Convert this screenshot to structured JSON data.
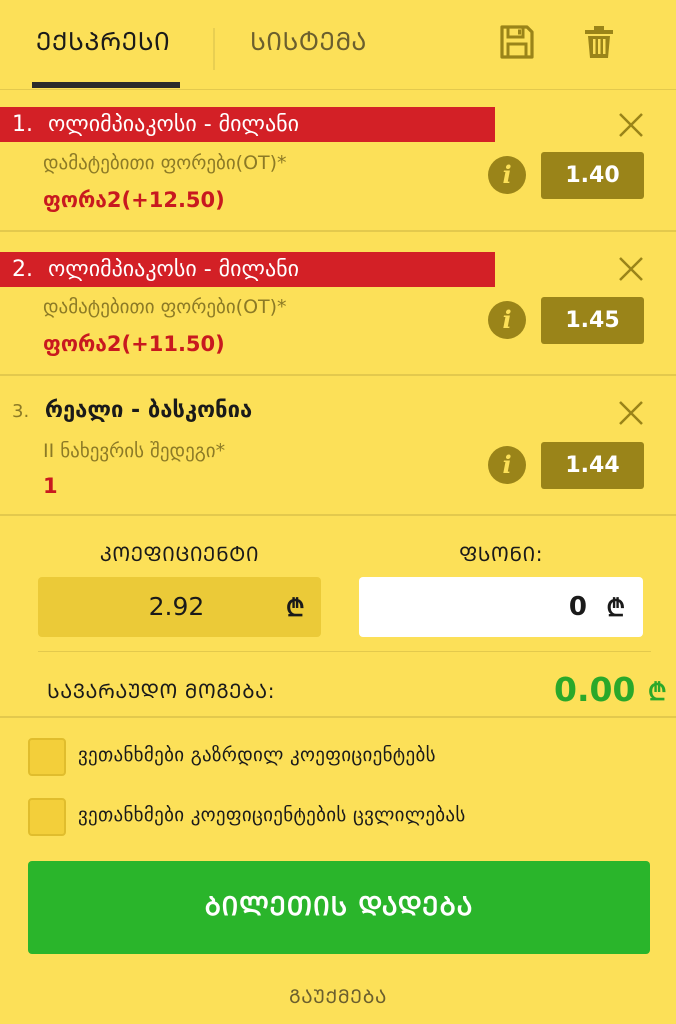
{
  "tabs": {
    "express": "ᲔᲥᲡᲞᲠᲔᲡᲘ",
    "system": "ᲡᲘᲡᲢᲔᲛᲐ"
  },
  "icons": {
    "save": "save-icon",
    "trash": "trash-icon",
    "close": "close-icon",
    "info": "info-icon",
    "currency": "lari-icon"
  },
  "bets": [
    {
      "number": "1.",
      "match": "ოლიმპიაკოსი - მილანი",
      "market": "დამატებითი ფორები(OT)*",
      "selection": "ფორა2(+12.50)",
      "odds": "1.40",
      "info_glyph": "i"
    },
    {
      "number": "2.",
      "match": "ოლიმპიაკოსი - მილანი",
      "market": "დამატებითი ფორები(OT)*",
      "selection": "ფორა2(+11.50)",
      "odds": "1.45",
      "info_glyph": "i"
    },
    {
      "number": "3.",
      "match": "რეალი - ბასკონია",
      "market": "II ნახევრის შედეგი*",
      "selection": "1",
      "odds": "1.44",
      "info_glyph": "i"
    }
  ],
  "summary": {
    "coef_label": "ᲙᲝᲔᲤᲘᲪᲘᲔᲜᲢᲘ",
    "coef_value": "2.92",
    "stake_label": "ᲤᲡᲝᲜᲘ:",
    "stake_value": "0",
    "currency_symbol": "₾",
    "win_label": "ᲡᲐᲕᲐᲠᲐᲣᲓᲝ ᲛᲝᲒᲔᲑᲐ:",
    "win_value": "0.00"
  },
  "options": {
    "accept_increased": "ვეთანხმები გაზრდილ კოეფიციენტებს",
    "accept_changes": "ვეთანხმები კოეფიციენტების ცვლილებას"
  },
  "actions": {
    "place_bet": "ᲑᲘᲚᲔᲗᲘᲡ ᲓᲐᲓᲔᲑᲐ",
    "cancel": "ᲒᲐᲣᲥᲛᲔᲑᲐ"
  },
  "colors": {
    "background": "#fce058",
    "title_red": "#d32026",
    "odds_bg": "#9a8419",
    "win_green": "#2aa82a",
    "button_green": "#2ab52b"
  }
}
